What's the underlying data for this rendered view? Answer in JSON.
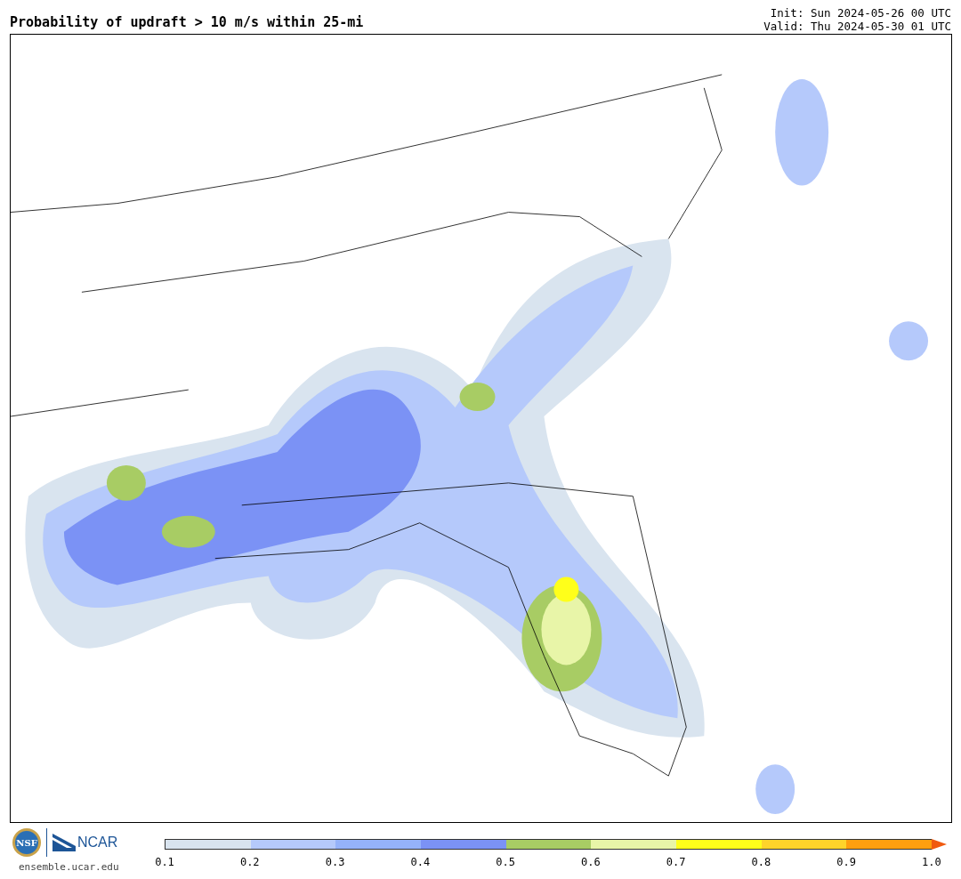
{
  "header": {
    "title": "Probability of updraft > 10 m/s within 25-mi",
    "init": "Init: Sun 2024-05-26 00 UTC",
    "valid": "Valid: Thu 2024-05-30 01 UTC"
  },
  "footer": {
    "nsf_logo": "NSF",
    "ncar_logo": "NCAR",
    "site": "ensemble.ucar.edu"
  },
  "colorbar": {
    "segments": [
      {
        "kind": "band",
        "color": "#d9e4ef"
      },
      {
        "kind": "band",
        "color": "#b5c9fb"
      },
      {
        "kind": "band",
        "color": "#95b2fa"
      },
      {
        "kind": "band",
        "color": "#7b92f5"
      },
      {
        "kind": "band",
        "color": "#a8cc64"
      },
      {
        "kind": "band",
        "color": "#e8f5a8"
      },
      {
        "kind": "band",
        "color": "#ffff1a"
      },
      {
        "kind": "band",
        "color": "#ffd42a"
      },
      {
        "kind": "band",
        "color": "#ff9f0e"
      },
      {
        "kind": "extend",
        "color": "#f05a10"
      }
    ],
    "labels": [
      "0.1",
      "0.2",
      "0.3",
      "0.4",
      "0.5",
      "0.6",
      "0.7",
      "0.8",
      "0.9",
      "1.0"
    ]
  }
}
